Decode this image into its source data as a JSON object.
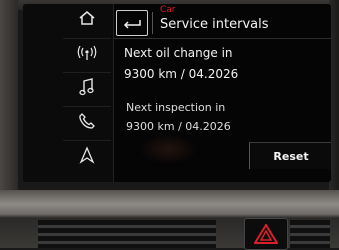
{
  "sidebar": {
    "items": [
      {
        "icon": "home-icon"
      },
      {
        "icon": "radio-icon"
      },
      {
        "icon": "music-note-icon"
      },
      {
        "icon": "phone-icon"
      },
      {
        "icon": "navigation-arrow-icon"
      }
    ]
  },
  "header": {
    "breadcrumb": "Car",
    "title": "Service intervals"
  },
  "oil_change": {
    "label": "Next oil change in",
    "value": "9300 km / 04.2026"
  },
  "inspection": {
    "label": "Next inspection in",
    "value": "9300 km / 04.2026"
  },
  "reset_label": "Reset",
  "colors": {
    "breadcrumb": "#d8202a",
    "text": "#f4f4f4",
    "screen_bg": "#050505",
    "hazard": "#d8202a"
  }
}
